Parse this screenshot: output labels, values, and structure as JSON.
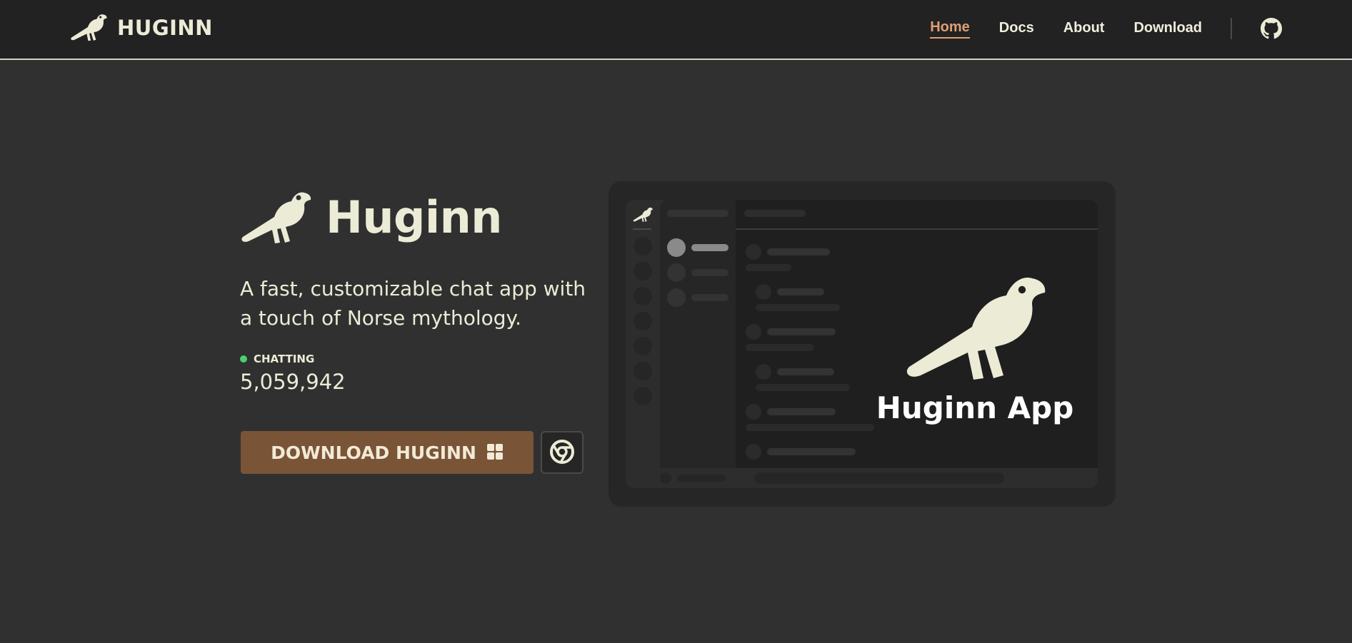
{
  "colors": {
    "background": "#303030",
    "topbar": "#222222",
    "accent": "#df9f74",
    "cream": "#ecebd6",
    "download_button": "#7a5437",
    "status_green": "#4ccf74"
  },
  "header": {
    "logo_icon": "raven-icon",
    "brand": "HUGINN",
    "nav": [
      {
        "label": "Home",
        "active": true
      },
      {
        "label": "Docs",
        "active": false
      },
      {
        "label": "About",
        "active": false
      },
      {
        "label": "Download",
        "active": false
      }
    ],
    "github_icon": "github-icon"
  },
  "hero": {
    "title": "Huginn",
    "tagline": "A fast, customizable chat app with a touch of Norse mythology.",
    "status_label": "CHATTING",
    "status_count": "5,059,942",
    "download_label": "DOWNLOAD HUGINN",
    "download_icon": "windows-icon",
    "browser_icon": "chrome-icon"
  },
  "preview": {
    "title": "Huginn App"
  }
}
